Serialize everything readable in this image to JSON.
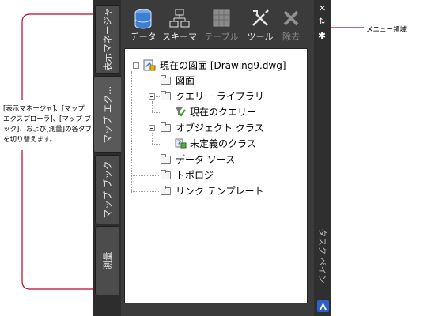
{
  "annotations": {
    "tabs_note": "[表示マネージャ]、[マップ エクスプローラ]、[マップ ブック]、および[測量]の各タブを切り替えます。",
    "menu_note": "メニュー領域"
  },
  "tabs": [
    {
      "label": "表示マネージャ",
      "active": false
    },
    {
      "label": "マップ エク…",
      "active": true
    },
    {
      "label": "マップ ブック",
      "active": false
    },
    {
      "label": "測量",
      "active": false
    }
  ],
  "toolbar": {
    "data": "データ",
    "schema": "スキーマ",
    "table": "テーブル",
    "tools": "ツール",
    "remove": "除去"
  },
  "tree": {
    "root": "現在の図面 [Drawing9.dwg]",
    "drawings": "図面",
    "query_library": "クエリー ライブラリ",
    "current_query": "現在のクエリー",
    "object_classes": "オブジェクト クラス",
    "undefined_class": "未定義のクラス",
    "data_sources": "データ ソース",
    "topology": "トポロジ",
    "link_templates": "リンク テンプレート"
  },
  "side_title": "タスク ペイン",
  "colors": {
    "frame": "#3b3b3b",
    "annotation_line": "#c0002c"
  }
}
